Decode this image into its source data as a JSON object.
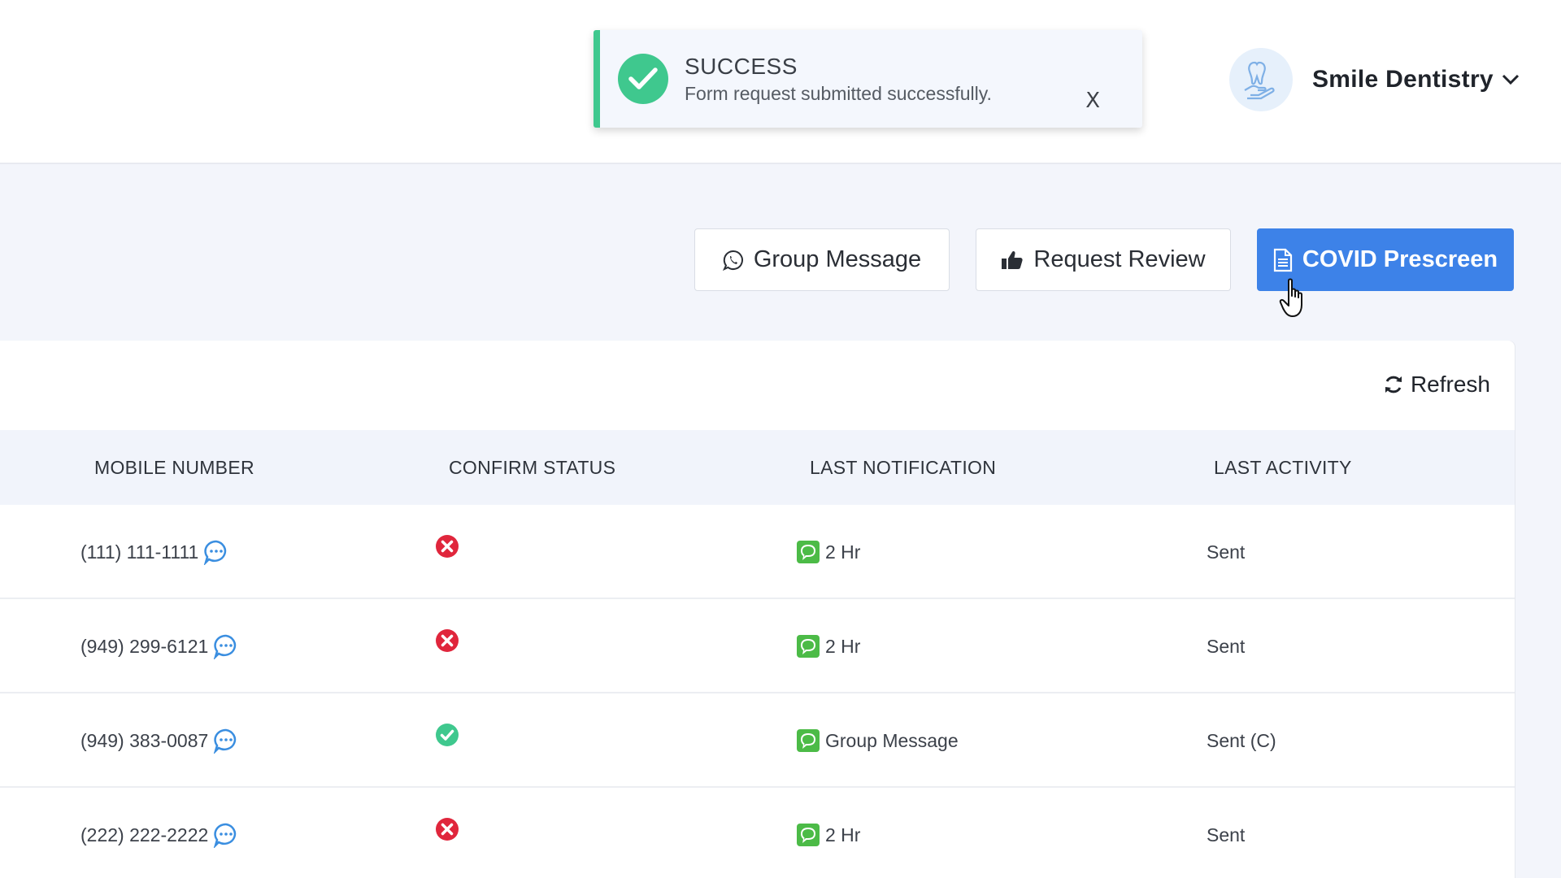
{
  "header": {
    "profile_name": "Smile Dentistry"
  },
  "toast": {
    "title": "SUCCESS",
    "message": "Form request submitted successfully.",
    "close_label": "X"
  },
  "actions": {
    "group_message": "Group Message",
    "request_review": "Request Review",
    "covid_prescreen": "COVID Prescreen"
  },
  "card": {
    "refresh_label": "Refresh"
  },
  "table": {
    "columns": [
      "MOBILE NUMBER",
      "CONFIRM STATUS",
      "LAST NOTIFICATION",
      "LAST ACTIVITY"
    ],
    "rows": [
      {
        "mobile": "(111) 111-1111",
        "confirm": "not-confirmed",
        "notification": "2 Hr",
        "activity": "Sent"
      },
      {
        "mobile": "(949) 299-6121",
        "confirm": "not-confirmed",
        "notification": "2 Hr",
        "activity": "Sent"
      },
      {
        "mobile": "(949) 383-0087",
        "confirm": "confirmed",
        "notification": "Group Message",
        "activity": "Sent (C)"
      },
      {
        "mobile": "(222) 222-2222",
        "confirm": "not-confirmed",
        "notification": "2 Hr",
        "activity": "Sent"
      }
    ]
  },
  "colors": {
    "primary": "#3d82e8",
    "success": "#3fc88e",
    "danger": "#e0263c",
    "sms_green": "#4cbb47",
    "chat_blue": "#3a8ee0"
  },
  "icons": {
    "avatar": "tooth-hand-icon",
    "toast": "check-circle-icon",
    "group_message": "whatsapp-icon",
    "request_review": "thumbs-up-icon",
    "covid_prescreen": "document-icon",
    "refresh": "refresh-icon",
    "chat": "chat-bubble-icon",
    "sms": "sms-icon",
    "not_confirmed": "x-circle-icon",
    "confirmed": "check-circle-icon"
  }
}
